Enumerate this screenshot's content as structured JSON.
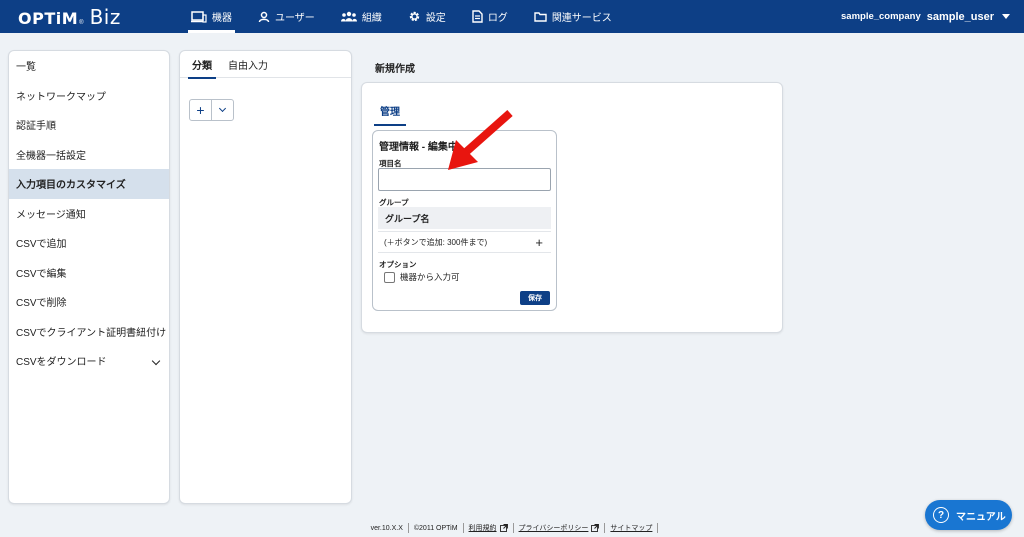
{
  "header": {
    "logo_main": "OPTiM",
    "logo_mark": "®",
    "logo_product": "Biz",
    "nav": [
      {
        "label": "機器",
        "icon": "device-icon",
        "active": true
      },
      {
        "label": "ユーザー",
        "icon": "user-icon",
        "active": false
      },
      {
        "label": "組織",
        "icon": "organization-icon",
        "active": false
      },
      {
        "label": "設定",
        "icon": "gear-icon",
        "active": false
      },
      {
        "label": "ログ",
        "icon": "log-icon",
        "active": false
      },
      {
        "label": "関連サービス",
        "icon": "folder-icon",
        "active": false
      }
    ],
    "company": "sample_company",
    "user": "sample_user"
  },
  "sidebar": {
    "items": [
      {
        "label": "一覧"
      },
      {
        "label": "ネットワークマップ"
      },
      {
        "label": "認証手順"
      },
      {
        "label": "全機器一括設定"
      },
      {
        "label": "入力項目のカスタマイズ",
        "active": true
      },
      {
        "label": "メッセージ通知"
      },
      {
        "label": "CSVで追加"
      },
      {
        "label": "CSVで編集"
      },
      {
        "label": "CSVで削除"
      },
      {
        "label": "CSVでクライアント証明書紐付け"
      },
      {
        "label": "CSVをダウンロード",
        "expandable": true
      }
    ]
  },
  "category_panel": {
    "tabs": [
      {
        "label": "分類",
        "active": true
      },
      {
        "label": "自由入力",
        "active": false
      }
    ],
    "add_symbol": "+"
  },
  "main": {
    "section_title": "新規作成",
    "tab_label": "管理",
    "card": {
      "title": "管理情報 - 編集中",
      "item_name_label": "項目名",
      "item_name_value": "",
      "group_label": "グループ",
      "group_column": "グループ名",
      "group_hint": "(＋ボタンで追加: 300件まで)",
      "add_symbol": "+",
      "option_label": "オプション",
      "option_checkbox_label": "機器から入力可",
      "option_checked": false,
      "save_label": "保存"
    }
  },
  "footer": {
    "version": "ver.10.X.X",
    "copyright": "©2011 OPTiM",
    "terms": "利用規約",
    "privacy": "プライバシーポリシー",
    "sitemap": "サイトマップ"
  },
  "manual_button": {
    "label": "マニュアル",
    "icon": "help-icon"
  },
  "colors": {
    "primary": "#0d3f86",
    "accent_button": "#1976d2",
    "annotation_arrow": "#e8150f",
    "sidebar_active": "#d5e0ec"
  }
}
